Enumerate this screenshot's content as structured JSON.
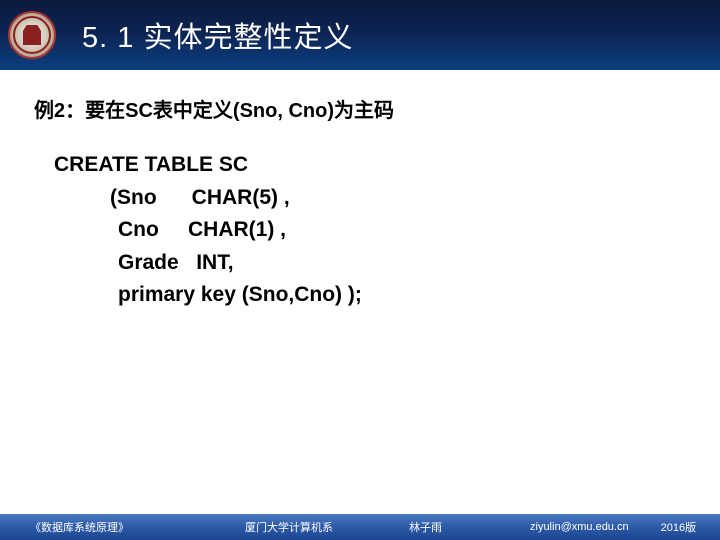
{
  "header": {
    "section_number": "5. 1",
    "section_title": "实体完整性定义"
  },
  "content": {
    "example_label": "例2：要在SC表中定义(Sno, Cno)为主码",
    "code": {
      "line1": "CREATE TABLE SC",
      "line2": "(Sno      CHAR(5) ,",
      "line3": "Cno     CHAR(1) ,",
      "line4": "Grade   INT,",
      "line5": "primary key (Sno,Cno) );"
    }
  },
  "footer": {
    "book": "《数据库系统原理》",
    "dept": "厦门大学计算机系",
    "author": "林子雨",
    "email": "ziyulin@xmu.edu.cn",
    "version": "2016版"
  }
}
